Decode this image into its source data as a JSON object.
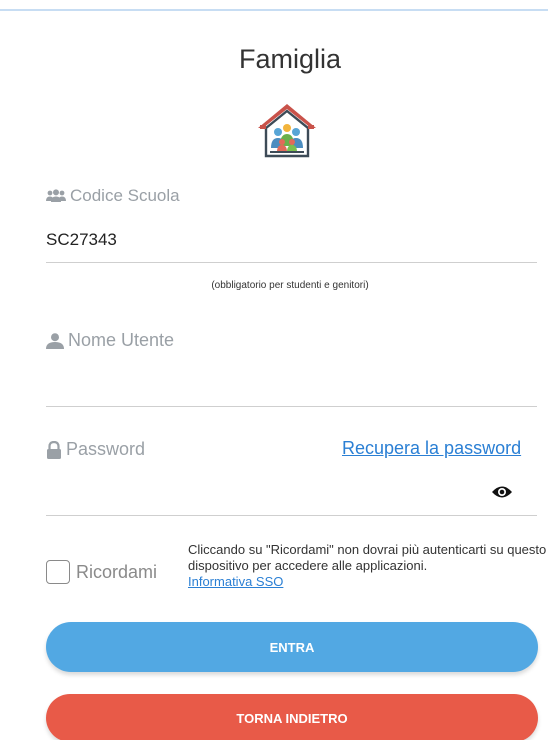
{
  "header": {
    "title": "Famiglia",
    "logo_icon": "family-house-icon"
  },
  "school_code": {
    "label": "Codice Scuola",
    "icon": "users-icon",
    "value": "SC27343",
    "hint": "(obbligatorio per studenti e genitori)"
  },
  "username": {
    "label": "Nome Utente",
    "icon": "user-icon",
    "value": ""
  },
  "password": {
    "label": "Password",
    "icon": "lock-icon",
    "value": "",
    "recover_link": "Recupera la password",
    "toggle_icon": "eye-icon"
  },
  "remember": {
    "label": "Ricordami",
    "checked": false,
    "note": "Cliccando su \"Ricordami\" non dovrai più autenticarti su questo dispositivo per accedere alle applicazioni.",
    "sso_link": "Informativa SSO"
  },
  "actions": {
    "enter_label": "ENTRA",
    "back_label": "TORNA INDIETRO"
  },
  "colors": {
    "primary": "#52a8e3",
    "danger": "#e85a48",
    "link": "#2a7fd4",
    "muted": "#9aa0a6"
  }
}
